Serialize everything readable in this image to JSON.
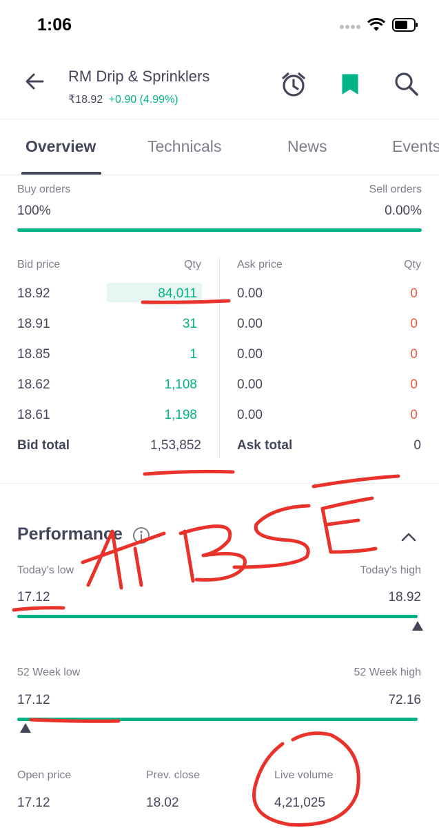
{
  "status_bar": {
    "time": "1:06"
  },
  "header": {
    "stock_name": "RM Drip & Sprinklers",
    "ltp": "₹18.92",
    "change": "+0.90 (4.99%)"
  },
  "tabs": [
    {
      "label": "Overview"
    },
    {
      "label": "Technicals"
    },
    {
      "label": "News"
    },
    {
      "label": "Events"
    }
  ],
  "market_depth": {
    "buy_orders_label": "Buy orders",
    "buy_orders_pct": "100%",
    "sell_orders_label": "Sell orders",
    "sell_orders_pct": "0.00%",
    "buy_share": 1.0,
    "bid_price_header": "Bid price",
    "qty_header": "Qty",
    "ask_price_header": "Ask price",
    "bids": [
      {
        "price": "18.92",
        "qty": "84,011"
      },
      {
        "price": "18.91",
        "qty": "31"
      },
      {
        "price": "18.85",
        "qty": "1"
      },
      {
        "price": "18.62",
        "qty": "1,108"
      },
      {
        "price": "18.61",
        "qty": "1,198"
      }
    ],
    "asks": [
      {
        "price": "0.00",
        "qty": "0"
      },
      {
        "price": "0.00",
        "qty": "0"
      },
      {
        "price": "0.00",
        "qty": "0"
      },
      {
        "price": "0.00",
        "qty": "0"
      },
      {
        "price": "0.00",
        "qty": "0"
      }
    ],
    "bid_total_label": "Bid total",
    "bid_total": "1,53,852",
    "ask_total_label": "Ask total",
    "ask_total": "0"
  },
  "performance": {
    "title": "Performance",
    "todays_low_label": "Today's low",
    "todays_low": "17.12",
    "todays_high_label": "Today's high",
    "todays_high": "18.92",
    "today_position": 1.0,
    "week52_low_label": "52 Week low",
    "week52_low": "17.12",
    "week52_high_label": "52 Week high",
    "week52_high": "72.16",
    "week52_position": 0.0,
    "open_price_label": "Open price",
    "open_price": "17.12",
    "prev_close_label": "Prev. close",
    "prev_close": "18.02",
    "live_volume_label": "Live volume",
    "live_volume": "4,21,025"
  },
  "colors": {
    "accent_green": "#00b386",
    "red": "#eb5b3c",
    "text_primary": "#44475b",
    "text_secondary": "#7c7e8c",
    "annotation_red": "#e8322a"
  },
  "annotation": {
    "handwritten_text": "At BSE"
  }
}
